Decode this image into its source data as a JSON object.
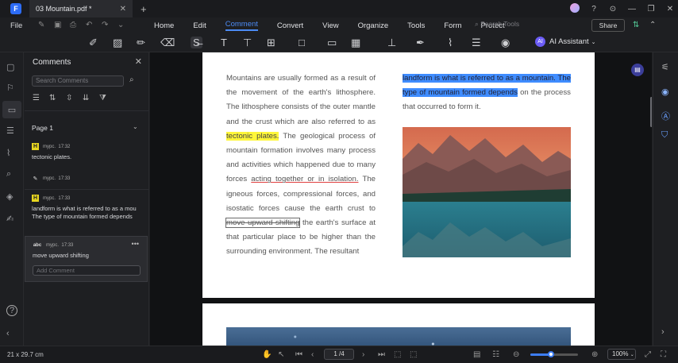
{
  "titlebar": {
    "tab_title": "03 Mountain.pdf *",
    "logo_letter": "F"
  },
  "menubar": {
    "file": "File",
    "menus": [
      "Home",
      "Edit",
      "Comment",
      "Convert",
      "View",
      "Organize",
      "Tools",
      "Form",
      "Protect"
    ],
    "active_menu": "Comment",
    "search_tools_placeholder": "Search Tools",
    "share": "Share"
  },
  "toolbar": {
    "ai_assistant": "AI Assistant",
    "ai_icon_text": "AI"
  },
  "panel": {
    "title": "Comments",
    "search_placeholder": "Search Comments",
    "page_label": "Page 1",
    "comments": [
      {
        "badge": "H",
        "author": "mypc.",
        "time": "17:32",
        "text": "tectonic plates."
      },
      {
        "badge": "✎",
        "author": "mypc.",
        "time": "17:33",
        "text": ""
      },
      {
        "badge": "H",
        "author": "mypc.",
        "time": "17:33",
        "text": "landform is what is referred to as a mou The type of mountain formed depends"
      },
      {
        "badge": "abc",
        "author": "mypc.",
        "time": "17:33",
        "text": "move upward shifting"
      }
    ],
    "add_comment_placeholder": "Add Comment"
  },
  "document": {
    "left_col": {
      "p1": "Mountains are usually formed as a result of the movement of the earth's lithosphere. The lithosphere consists of the outer mantle and the crust which are also referred to as ",
      "hl": "tectonic plates.",
      "p2": " The geological process of mountain formation involves many process and activities which happened due to many forces ",
      "under": "acting together or in isolation.",
      "p3": " The igneous forces, compressional forces, and isostatic forces cause the earth crust to ",
      "strike": "move upward shifting",
      "p4": " the earth's surface at that particular place to be higher than the surrounding environment. The resultant"
    },
    "right_col": {
      "hl": "landform is what is referred to as a mountain. The type of mountain formed depends",
      "rest": " on the process that occurred to form it."
    }
  },
  "status": {
    "dimensions": "21 x 29.7 cm",
    "page": "1 /4",
    "zoom": "100%",
    "zoom_level": 0.45
  },
  "colors": {
    "accent": "#4c8bf5",
    "highlight_yellow": "#fff63a",
    "highlight_blue": "#3f8cff"
  }
}
